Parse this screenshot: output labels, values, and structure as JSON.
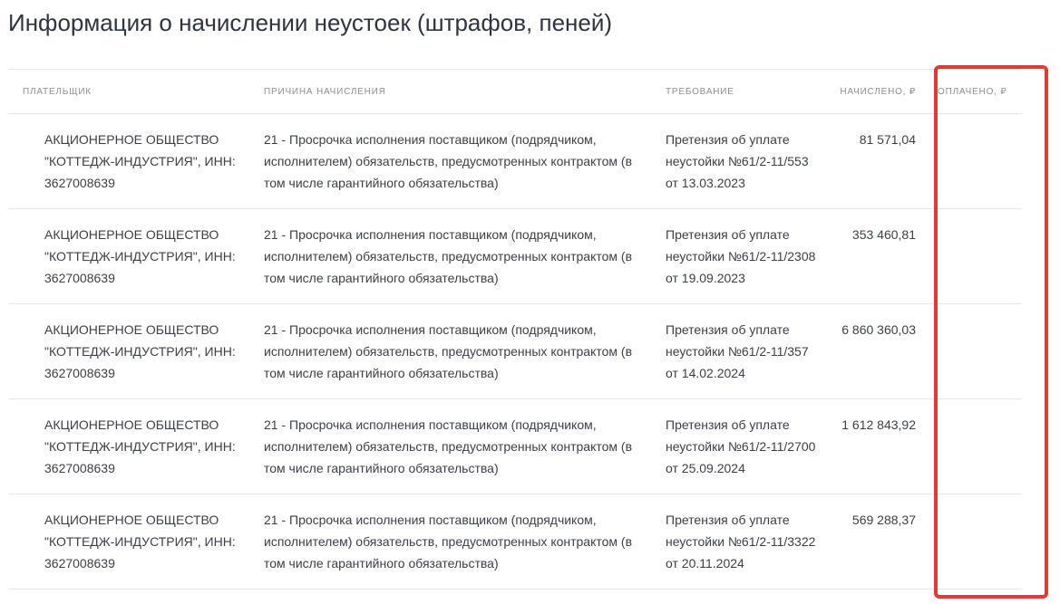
{
  "page": {
    "title": "Информация о начислении неустоек (штрафов, пеней)"
  },
  "table": {
    "headers": {
      "payer": "ПЛАТЕЛЬЩИК",
      "reason": "ПРИЧИНА НАЧИСЛЕНИЯ",
      "requirement": "ТРЕБОВАНИЕ",
      "accrued": "НАЧИСЛЕНО, ₽",
      "paid": "ОПЛАЧЕНО, ₽"
    },
    "rows": [
      {
        "payer": "АКЦИОНЕРНОЕ ОБЩЕСТВО \"КОТТЕДЖ-ИНДУСТРИЯ\", ИНН: 3627008639",
        "reason": "21 - Просрочка исполнения поставщиком (подрядчиком, исполнителем) обязательств, предусмотренных контрактом (в том числе гарантийного обязательства)",
        "requirement": "Претензия об уплате неустойки №61/2-11/553 от 13.03.2023",
        "accrued": "81 571,04",
        "paid": ""
      },
      {
        "payer": "АКЦИОНЕРНОЕ ОБЩЕСТВО \"КОТТЕДЖ-ИНДУСТРИЯ\", ИНН: 3627008639",
        "reason": "21 - Просрочка исполнения поставщиком (подрядчиком, исполнителем) обязательств, предусмотренных контрактом (в том числе гарантийного обязательства)",
        "requirement": "Претензия об уплате неустойки №61/2-11/2308 от 19.09.2023",
        "accrued": "353 460,81",
        "paid": ""
      },
      {
        "payer": "АКЦИОНЕРНОЕ ОБЩЕСТВО \"КОТТЕДЖ-ИНДУСТРИЯ\", ИНН: 3627008639",
        "reason": "21 - Просрочка исполнения поставщиком (подрядчиком, исполнителем) обязательств, предусмотренных контрактом (в том числе гарантийного обязательства)",
        "requirement": "Претензия об уплате неустойки №61/2-11/357 от 14.02.2024",
        "accrued": "6 860 360,03",
        "paid": ""
      },
      {
        "payer": "АКЦИОНЕРНОЕ ОБЩЕСТВО \"КОТТЕДЖ-ИНДУСТРИЯ\", ИНН: 3627008639",
        "reason": "21 - Просрочка исполнения поставщиком (подрядчиком, исполнителем) обязательств, предусмотренных контрактом (в том числе гарантийного обязательства)",
        "requirement": "Претензия об уплате неустойки №61/2-11/2700 от 25.09.2024",
        "accrued": "1 612 843,92",
        "paid": ""
      },
      {
        "payer": "АКЦИОНЕРНОЕ ОБЩЕСТВО \"КОТТЕДЖ-ИНДУСТРИЯ\", ИНН: 3627008639",
        "reason": "21 - Просрочка исполнения поставщиком (подрядчиком, исполнителем) обязательств, предусмотренных контрактом (в том числе гарантийного обязательства)",
        "requirement": "Претензия об уплате неустойки №61/2-11/3322 от 20.11.2024",
        "accrued": "569 288,37",
        "paid": ""
      }
    ]
  },
  "annotation": {
    "highlight_color": "#e53935"
  }
}
